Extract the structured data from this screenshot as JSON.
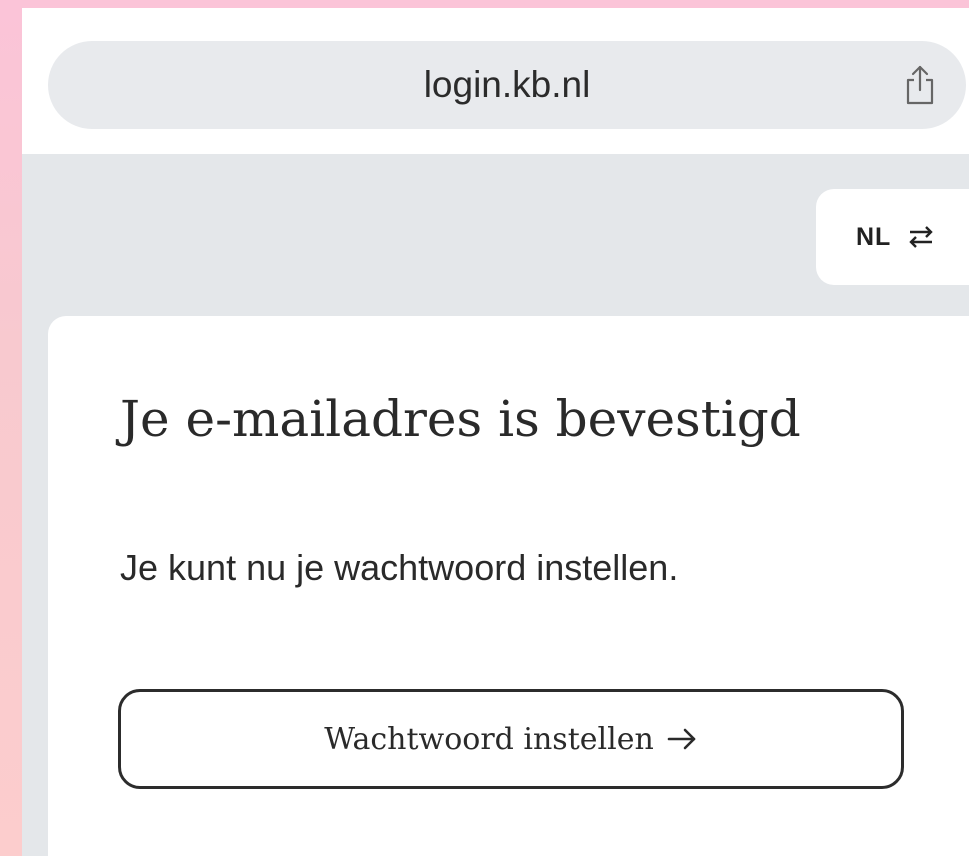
{
  "browser": {
    "url": "login.kb.nl",
    "share_icon": "share-icon"
  },
  "language": {
    "current": "NL",
    "icon": "swap-arrows-icon"
  },
  "card": {
    "title": "Je e-mailadres is bevestigd",
    "message": "Je kunt nu je wachtwoord instellen.",
    "button_label": "Wachtwoord instellen",
    "button_icon": "arrow-right-icon"
  },
  "colors": {
    "background_gradient": "#fbc4d8",
    "page_background": "#e4e7ea",
    "card_background": "#ffffff",
    "url_pill": "#e8eaed",
    "text": "#2a2a2a"
  }
}
